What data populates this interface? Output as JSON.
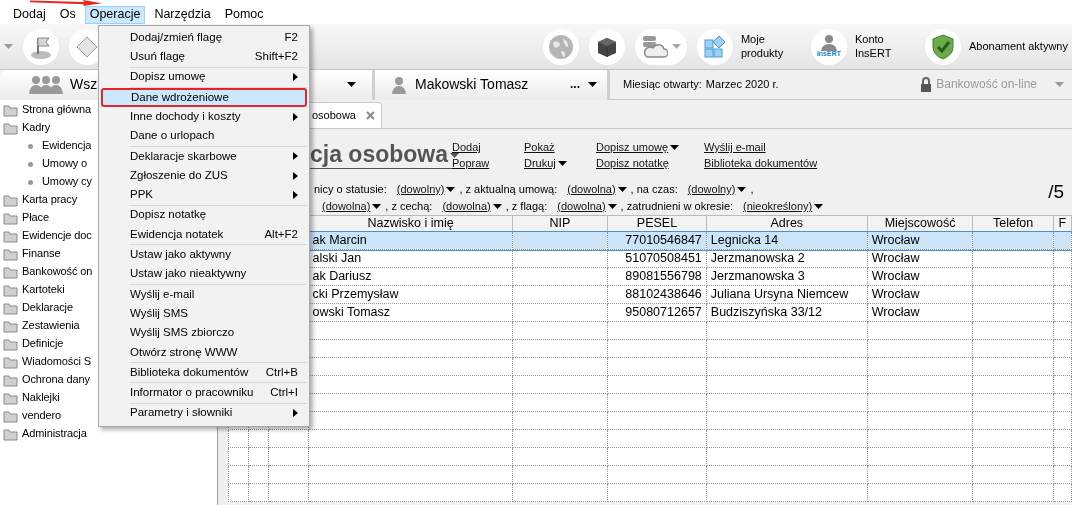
{
  "menubar": [
    {
      "label": "Dodaj",
      "selected": false
    },
    {
      "label": "Os",
      "selected": false
    },
    {
      "label": "Operacje",
      "selected": true
    },
    {
      "label": "Narzędzia",
      "selected": false
    },
    {
      "label": "Pomoc",
      "selected": false
    }
  ],
  "quick_buttons": [
    {
      "kind": "products",
      "label": "Moje produkty"
    },
    {
      "kind": "account",
      "label": "Konto InsERT",
      "badge": "InsERT"
    },
    {
      "kind": "subscription",
      "label": "Abonament aktywny"
    }
  ],
  "context_bar": {
    "group": "Wsz",
    "person": "Makowski Tomasz",
    "more": "...",
    "month_label": "Miesiąc otwarty:",
    "month_value": "Marzec 2020 r.",
    "banking": "Bankowość on-line",
    "banking_disabled": true
  },
  "sidebar": {
    "items": [
      {
        "label": "Strona główna"
      },
      {
        "label": "Kadry",
        "children": [
          {
            "label": "Ewidencja"
          },
          {
            "label": "Umowy o"
          },
          {
            "label": "Umowy cy"
          }
        ]
      },
      {
        "label": "Karta pracy"
      },
      {
        "label": "Płace"
      },
      {
        "label": "Ewidencje doc"
      },
      {
        "label": "Finanse"
      },
      {
        "label": "Bankowość on"
      },
      {
        "label": "Kartoteki"
      },
      {
        "label": "Deklaracje"
      },
      {
        "label": "Zestawienia"
      },
      {
        "label": "Definicje"
      },
      {
        "label": "Wiadomości S"
      },
      {
        "label": "Ochrona dany"
      },
      {
        "label": "Naklejki"
      },
      {
        "label": "vendero"
      },
      {
        "label": "Administracja"
      }
    ]
  },
  "document_tab": {
    "label": "osobowa"
  },
  "header": {
    "title": "cja osobowa",
    "actions": [
      [
        {
          "label": "Dodaj",
          "dropdown": false
        },
        {
          "label": "Popraw",
          "dropdown": false
        }
      ],
      [
        {
          "label": "Pokaż",
          "dropdown": false
        },
        {
          "label": "Drukuj",
          "dropdown": true
        }
      ],
      [
        {
          "label": "Dopisz umowę",
          "dropdown": true
        },
        {
          "label": "Dopisz notatkę",
          "dropdown": false
        }
      ],
      [
        {
          "label": "Wyślij e-mail",
          "dropdown": false
        },
        {
          "label": "Biblioteka dokumentów",
          "dropdown": false
        }
      ]
    ]
  },
  "filters": [
    [
      {
        "kind": "text",
        "text": "nicy o statusie:"
      },
      {
        "kind": "link",
        "text": "(dowolny)"
      },
      {
        "kind": "text",
        "text": ", z aktualną umową:"
      },
      {
        "kind": "link",
        "text": "(dowolna)"
      },
      {
        "kind": "text",
        "text": ", na czas:"
      },
      {
        "kind": "link",
        "text": "(dowolny)"
      },
      {
        "kind": "text",
        "text": ","
      }
    ],
    [
      {
        "kind": "link",
        "text": "(dowolna)"
      },
      {
        "kind": "text",
        "text": ", z cechą:"
      },
      {
        "kind": "link",
        "text": "(dowolna)"
      },
      {
        "kind": "text",
        "text": ", z flagą:"
      },
      {
        "kind": "link",
        "text": "(dowolna)"
      },
      {
        "kind": "text",
        "text": ", zatrudnieni w okresie:"
      },
      {
        "kind": "link",
        "text": "(nieokreślony)"
      }
    ]
  ],
  "count": "/5",
  "table": {
    "columns": [
      "Nazwisko i imię",
      "NIP",
      "PESEL",
      "Adres",
      "Miejscowość",
      "Telefon",
      "F"
    ],
    "rows": [
      {
        "name": "ak Marcin",
        "pesel": "77010546847",
        "address": "Legnicka 14",
        "city": "Wrocław",
        "selected": true
      },
      {
        "name": "alski Jan",
        "pesel": "51070508451",
        "address": "Jerzmanowska 2",
        "city": "Wrocław",
        "selected": false
      },
      {
        "name": "ak Dariusz",
        "pesel": "89081556798",
        "address": "Jerzmanowska 3",
        "city": "Wrocław",
        "selected": false
      },
      {
        "name": "cki Przemysław",
        "pesel": "88102438646",
        "address": "Juliana Ursyna Niemcew",
        "city": "Wrocław",
        "selected": false
      },
      {
        "name": "owski Tomasz",
        "pesel": "95080712657",
        "address": "Budziszyńska 33/12",
        "city": "Wrocław",
        "selected": false
      }
    ]
  },
  "menu": {
    "sections": [
      {
        "items": [
          {
            "label": "Dodaj/zmień flagę",
            "shortcut": "F2",
            "submenu": false,
            "selected": false,
            "annotated": false
          },
          {
            "label": "Usuń flagę",
            "shortcut": "Shift+F2",
            "submenu": false,
            "selected": false,
            "annotated": false
          }
        ]
      },
      {
        "items": [
          {
            "label": "Dopisz umowę",
            "submenu": true,
            "selected": false,
            "annotated": false
          }
        ]
      },
      {
        "items": [
          {
            "label": "Dane wdrożeniowe",
            "submenu": false,
            "selected": true,
            "annotated": true
          },
          {
            "label": "Inne dochody i koszty",
            "submenu": true,
            "selected": false,
            "annotated": false
          },
          {
            "label": "Dane o urlopach",
            "submenu": false,
            "selected": false,
            "annotated": false
          }
        ]
      },
      {
        "items": [
          {
            "label": "Deklaracje skarbowe",
            "submenu": true,
            "selected": false,
            "annotated": false
          },
          {
            "label": "Zgłoszenie do ZUS",
            "submenu": true,
            "selected": false,
            "annotated": false
          },
          {
            "label": "PPK",
            "submenu": true,
            "selected": false,
            "annotated": false
          }
        ]
      },
      {
        "items": [
          {
            "label": "Dopisz notatkę",
            "submenu": false,
            "selected": false,
            "annotated": false
          },
          {
            "label": "Ewidencja notatek",
            "shortcut": "Alt+F2",
            "submenu": false,
            "selected": false,
            "annotated": false
          }
        ]
      },
      {
        "items": [
          {
            "label": "Ustaw jako aktywny",
            "submenu": false,
            "selected": false,
            "annotated": false
          },
          {
            "label": "Ustaw jako nieaktywny",
            "submenu": false,
            "selected": false,
            "annotated": false
          }
        ]
      },
      {
        "items": [
          {
            "label": "Wyślij e-mail",
            "submenu": false,
            "selected": false,
            "annotated": false
          },
          {
            "label": "Wyślij SMS",
            "submenu": false,
            "selected": false,
            "annotated": false
          },
          {
            "label": "Wyślij SMS zbiorczo",
            "submenu": false,
            "selected": false,
            "annotated": false
          },
          {
            "label": "Otwórz stronę WWW",
            "submenu": false,
            "selected": false,
            "annotated": false
          }
        ]
      },
      {
        "items": [
          {
            "label": "Biblioteka dokumentów",
            "shortcut": "Ctrl+B",
            "submenu": false,
            "selected": false,
            "annotated": false
          }
        ]
      },
      {
        "items": [
          {
            "label": "Informator o pracowniku",
            "shortcut": "Ctrl+I",
            "submenu": false,
            "selected": false,
            "annotated": false
          }
        ]
      },
      {
        "items": [
          {
            "label": "Parametry i słowniki",
            "submenu": true,
            "selected": false,
            "annotated": false
          }
        ]
      }
    ]
  }
}
